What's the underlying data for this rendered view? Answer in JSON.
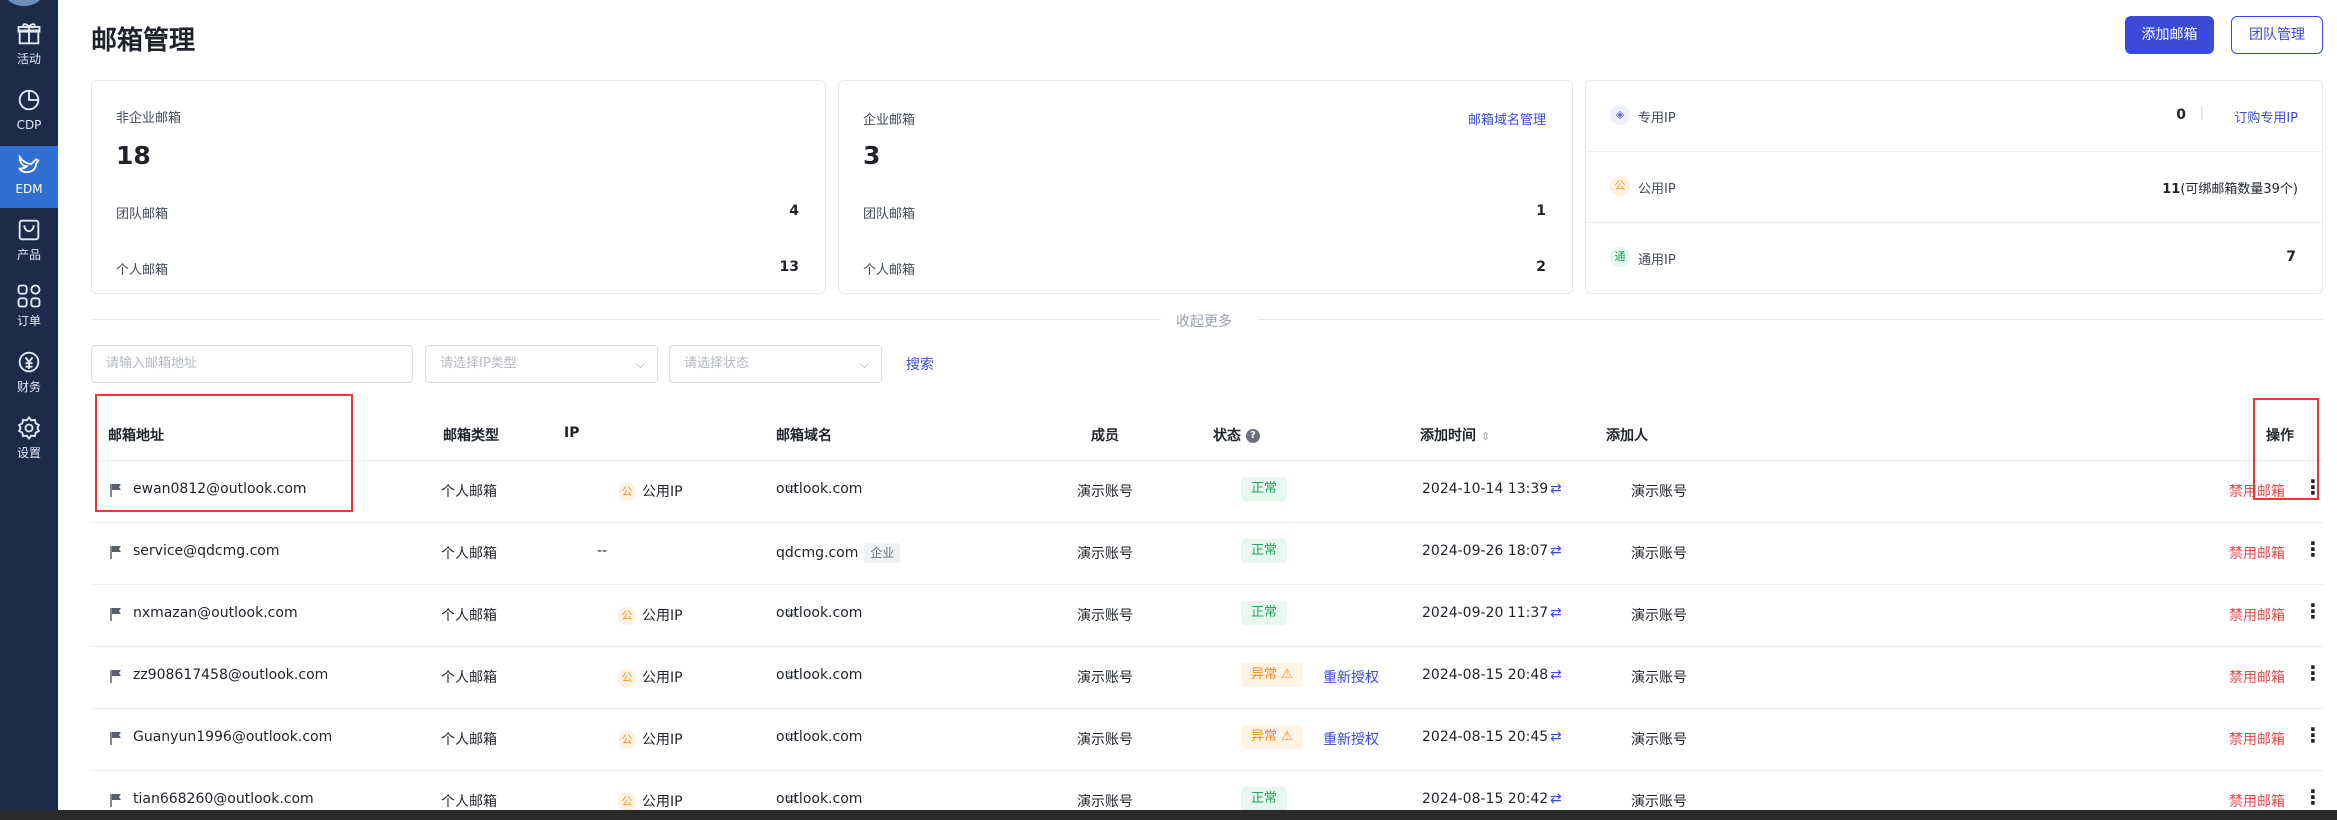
{
  "sidebar": {
    "items": [
      {
        "label": "活动",
        "icon": "gift-icon"
      },
      {
        "label": "CDP",
        "icon": "pie-chart-icon"
      },
      {
        "label": "EDM",
        "icon": "bird-icon"
      },
      {
        "label": "产品",
        "icon": "bag-icon"
      },
      {
        "label": "订单",
        "icon": "grid-icon"
      },
      {
        "label": "财务",
        "icon": "money-icon"
      },
      {
        "label": "设置",
        "icon": "gear-icon"
      }
    ],
    "active": "EDM"
  },
  "header": {
    "title": "邮箱管理",
    "add_button": "添加邮箱",
    "team_button": "团队管理"
  },
  "stats": {
    "non_enterprise": {
      "label": "非企业邮箱",
      "total": "18",
      "team_label": "团队邮箱",
      "team": "4",
      "personal_label": "个人邮箱",
      "personal": "13"
    },
    "enterprise": {
      "label": "企业邮箱",
      "total": "3",
      "domain_link": "邮箱域名管理",
      "team_label": "团队邮箱",
      "team": "1",
      "personal_label": "个人邮箱",
      "personal": "2"
    },
    "ip": {
      "dedicated_label": "专用IP",
      "dedicated": "0",
      "subscribe_link": "订购专用IP",
      "public_label": "公用IP",
      "public_count": "11",
      "public_note": "(可绑邮箱数量39个)",
      "general_label": "通用IP",
      "general": "7"
    }
  },
  "collapse_text": "收起更多",
  "filters": {
    "email_placeholder": "请输入邮箱地址",
    "ip_type_placeholder": "请选择IP类型",
    "status_placeholder": "请选择状态",
    "search_label": "搜索"
  },
  "table": {
    "headers": {
      "email": "邮箱地址",
      "type": "邮箱类型",
      "ip": "IP",
      "domain": "邮箱域名",
      "member": "成员",
      "status": "状态",
      "added_time": "添加时间",
      "added_by": "添加人",
      "actions": "操作"
    },
    "rows": [
      {
        "email": "ewan0812@outlook.com",
        "type": "个人邮箱",
        "ip": "公用IP",
        "domain": "outlook.com",
        "domain_tag": "",
        "member": "演示账号",
        "status": "正常",
        "status_kind": "ok",
        "reauth": "",
        "time": "2024-10-14 13:39",
        "added_by": "演示账号",
        "action": "禁用邮箱"
      },
      {
        "email": "service@qdcmg.com",
        "type": "个人邮箱",
        "ip": "--",
        "domain": "qdcmg.com",
        "domain_tag": "企业",
        "member": "演示账号",
        "status": "正常",
        "status_kind": "ok",
        "reauth": "",
        "time": "2024-09-26 18:07",
        "added_by": "演示账号",
        "action": "禁用邮箱"
      },
      {
        "email": "nxmazan@outlook.com",
        "type": "个人邮箱",
        "ip": "公用IP",
        "domain": "outlook.com",
        "domain_tag": "",
        "member": "演示账号",
        "status": "正常",
        "status_kind": "ok",
        "reauth": "",
        "time": "2024-09-20 11:37",
        "added_by": "演示账号",
        "action": "禁用邮箱"
      },
      {
        "email": "zz908617458@outlook.com",
        "type": "个人邮箱",
        "ip": "公用IP",
        "domain": "outlook.com",
        "domain_tag": "",
        "member": "演示账号",
        "status": "异常",
        "status_kind": "warn",
        "reauth": "重新授权",
        "time": "2024-08-15 20:48",
        "added_by": "演示账号",
        "action": "禁用邮箱"
      },
      {
        "email": "Guanyun1996@outlook.com",
        "type": "个人邮箱",
        "ip": "公用IP",
        "domain": "outlook.com",
        "domain_tag": "",
        "member": "演示账号",
        "status": "异常",
        "status_kind": "warn",
        "reauth": "重新授权",
        "time": "2024-08-15 20:45",
        "added_by": "演示账号",
        "action": "禁用邮箱"
      },
      {
        "email": "tian668260@outlook.com",
        "type": "个人邮箱",
        "ip": "公用IP",
        "domain": "outlook.com",
        "domain_tag": "",
        "member": "演示账号",
        "status": "正常",
        "status_kind": "ok",
        "reauth": "",
        "time": "2024-08-15 20:42",
        "added_by": "演示账号",
        "action": "禁用邮箱"
      }
    ]
  },
  "colors": {
    "accent": "#3b4bd8",
    "sidebar": "#1c2b4a",
    "danger": "#e5484d",
    "ok": "#21a558",
    "warn": "#f08a24",
    "highlight": "#e53935"
  }
}
